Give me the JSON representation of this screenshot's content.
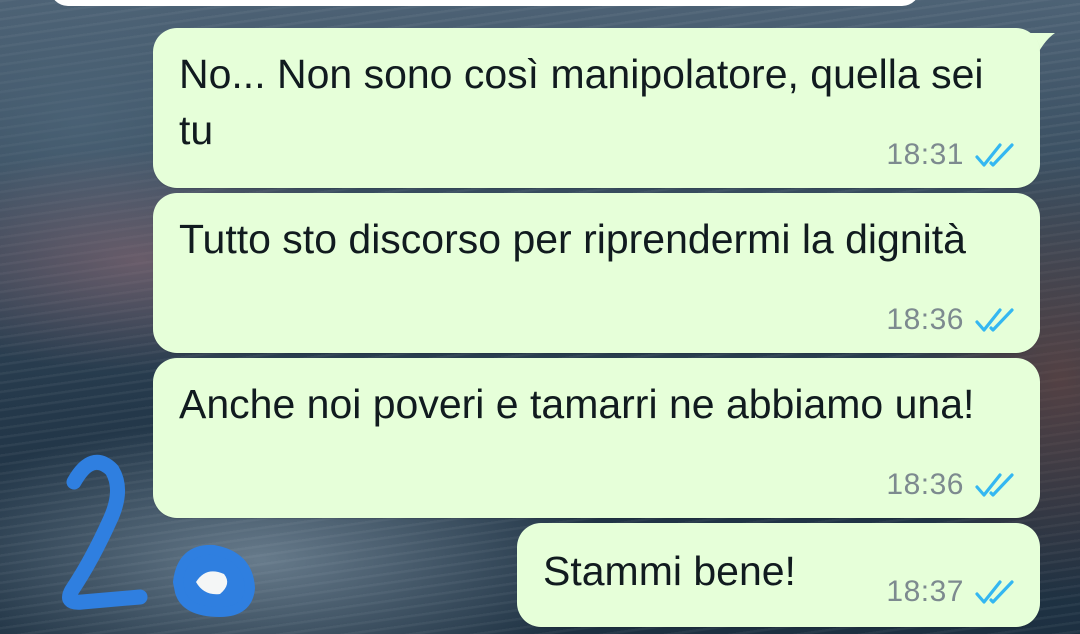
{
  "chat": {
    "messages": [
      {
        "text": "No... Non sono così manipolatore, quella sei tu",
        "time": "18:31",
        "status": "read-double-check"
      },
      {
        "text": "Tutto sto discorso per riprendermi la dignità",
        "time": "18:36",
        "status": "read-double-check"
      },
      {
        "text": "Anche noi poveri e tamarri ne abbiamo una!",
        "time": "18:36",
        "status": "read-double-check"
      },
      {
        "text": "Stammi bene!",
        "time": "18:37",
        "status": "read-double-check"
      }
    ]
  },
  "colors": {
    "bubble_outgoing": "#e6ffd9",
    "read_tick": "#34b7f1",
    "time_text": "#7d8a8f",
    "doodle": "#2f7fe0"
  },
  "overlay": {
    "handwritten_text": "20"
  }
}
